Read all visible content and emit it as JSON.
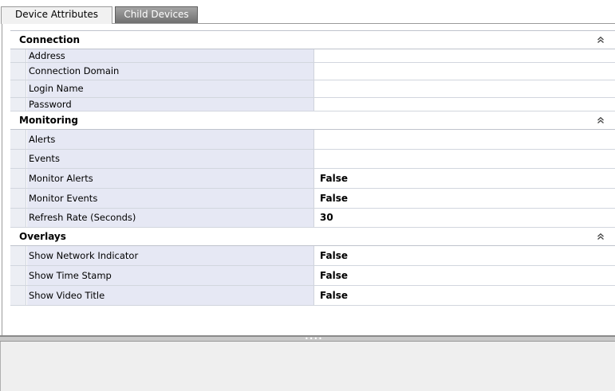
{
  "tabs": {
    "device_attributes": "Device Attributes",
    "child_devices": "Child Devices"
  },
  "categories": {
    "connection": "Connection",
    "monitoring": "Monitoring",
    "overlays": "Overlays"
  },
  "collapse_icon": "double-chevron-up-icon",
  "collapse_glyph": "≈",
  "rows": {
    "address": {
      "name": "Address",
      "value": ""
    },
    "connection_domain": {
      "name": "Connection Domain",
      "value": ""
    },
    "login_name": {
      "name": "Login Name",
      "value": ""
    },
    "password": {
      "name": "Password",
      "value": ""
    },
    "alerts": {
      "name": "Alerts",
      "value": ""
    },
    "events": {
      "name": "Events",
      "value": ""
    },
    "monitor_alerts": {
      "name": "Monitor Alerts",
      "value": "False"
    },
    "monitor_events": {
      "name": "Monitor Events",
      "value": "False"
    },
    "refresh_rate": {
      "name": "Refresh Rate (Seconds)",
      "value": "30"
    },
    "show_network_indicator": {
      "name": "Show Network Indicator",
      "value": "False"
    },
    "show_time_stamp": {
      "name": "Show Time Stamp",
      "value": "False"
    },
    "show_video_title": {
      "name": "Show Video Title",
      "value": "False"
    }
  },
  "colors": {
    "name_column_bg": "#e6e8f4",
    "inactive_tab_bg": "#7f7f7f"
  }
}
